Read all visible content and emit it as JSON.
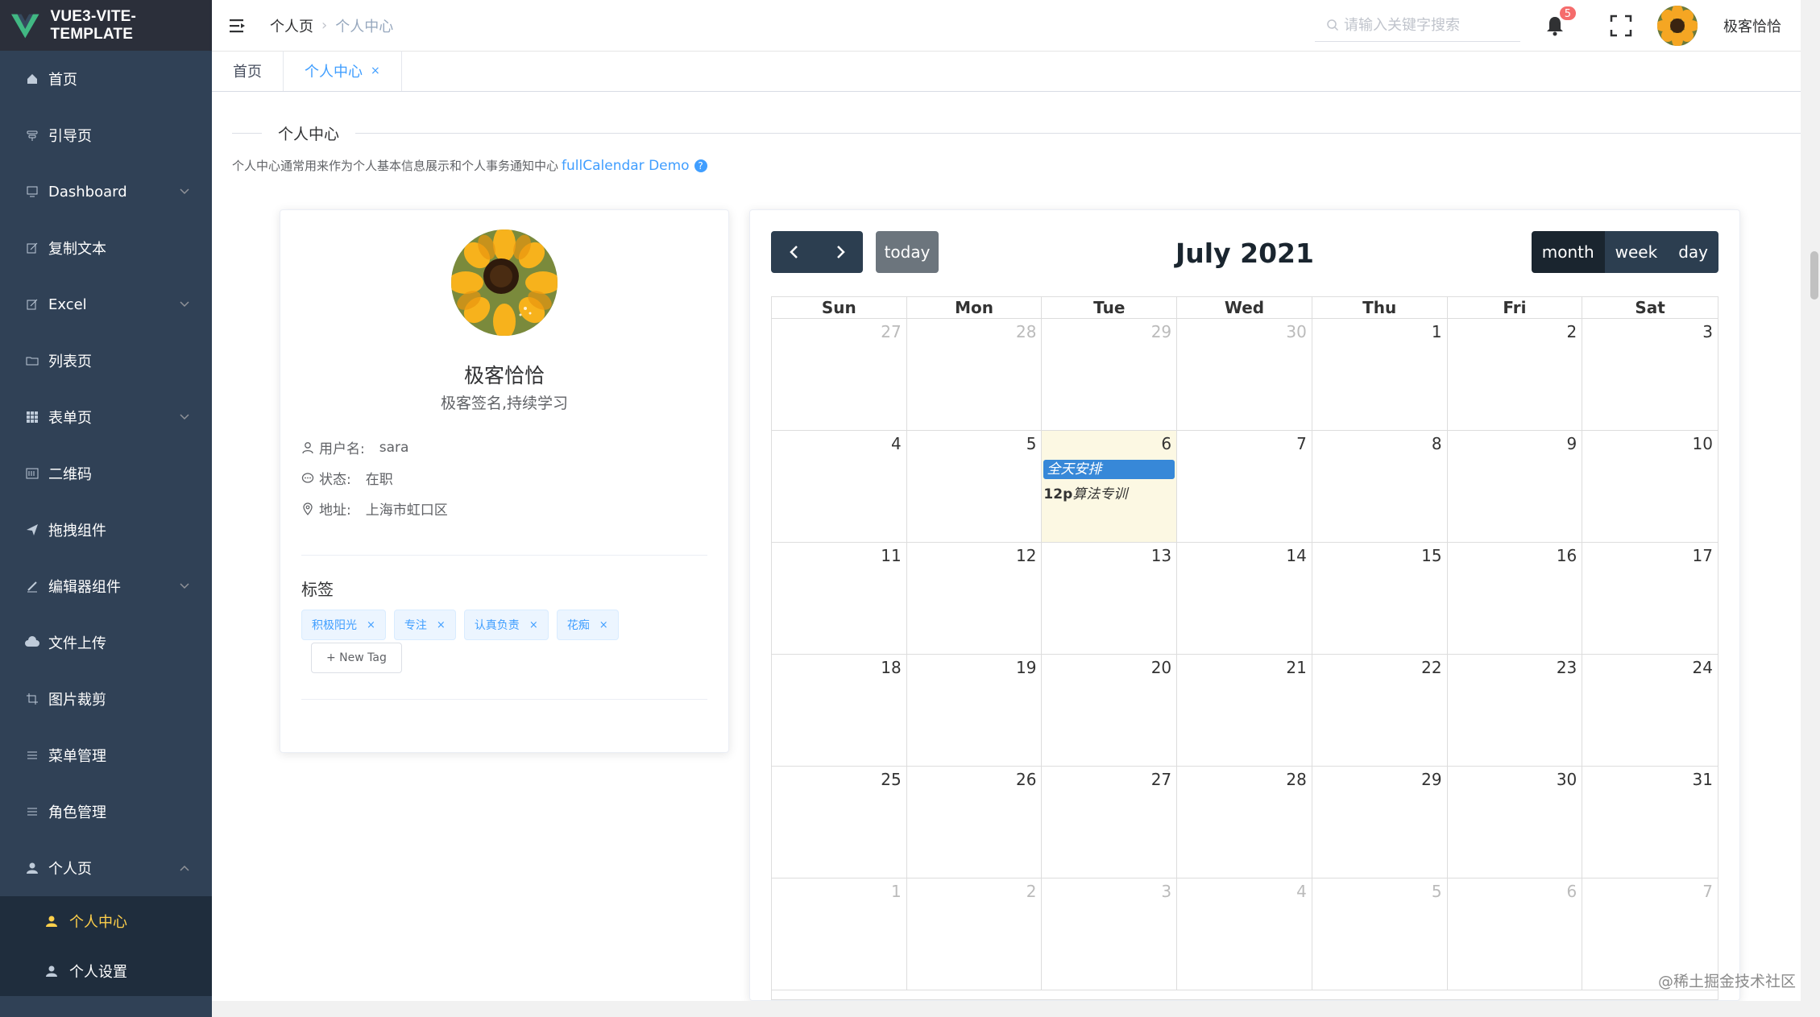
{
  "app": {
    "logo_text": "VUE3-VITE-TEMPLATE"
  },
  "sidebar": {
    "items": [
      {
        "label": "首页",
        "icon": "home-icon",
        "has_arrow": false
      },
      {
        "label": "引导页",
        "icon": "guide-icon",
        "has_arrow": false
      },
      {
        "label": "Dashboard",
        "icon": "dashboard-icon",
        "has_arrow": true
      },
      {
        "label": "复制文本",
        "icon": "copy-icon",
        "has_arrow": false
      },
      {
        "label": "Excel",
        "icon": "excel-icon",
        "has_arrow": true
      },
      {
        "label": "列表页",
        "icon": "folder-icon",
        "has_arrow": false
      },
      {
        "label": "表单页",
        "icon": "grid-icon",
        "has_arrow": true
      },
      {
        "label": "二维码",
        "icon": "qrcode-icon",
        "has_arrow": false
      },
      {
        "label": "拖拽组件",
        "icon": "send-icon",
        "has_arrow": false
      },
      {
        "label": "编辑器组件",
        "icon": "edit-icon",
        "has_arrow": true
      },
      {
        "label": "文件上传",
        "icon": "cloud-upload-icon",
        "has_arrow": false
      },
      {
        "label": "图片裁剪",
        "icon": "crop-icon",
        "has_arrow": false
      },
      {
        "label": "菜单管理",
        "icon": "list-icon",
        "has_arrow": false
      },
      {
        "label": "角色管理",
        "icon": "list-icon",
        "has_arrow": false
      },
      {
        "label": "个人页",
        "icon": "user-icon",
        "has_arrow": true
      }
    ],
    "submenu": [
      {
        "label": "个人中心",
        "active": true
      },
      {
        "label": "个人设置",
        "active": false
      }
    ]
  },
  "header": {
    "breadcrumb": [
      "个人页",
      "个人中心"
    ],
    "search_placeholder": "请输入关键字搜索",
    "notification_count": "5",
    "username": "极客恰恰"
  },
  "tags_view": {
    "tabs": [
      {
        "label": "首页",
        "active": false
      },
      {
        "label": "个人中心",
        "active": true,
        "close": "×"
      }
    ]
  },
  "main": {
    "divider_text": "个人中心",
    "description": "个人中心通常用来作为个人基本信息展示和个人事务通知中心",
    "link_text": "fullCalendar Demo",
    "help_icon": "?"
  },
  "profile": {
    "name": "极客恰恰",
    "signature": "极客签名,持续学习",
    "info": [
      {
        "icon": "user-icon",
        "label": "用户名:",
        "value": "sara"
      },
      {
        "icon": "chat-icon",
        "label": "状态:",
        "value": "在职"
      },
      {
        "icon": "location-icon",
        "label": "地址:",
        "value": "上海市虹口区"
      }
    ],
    "tags_title": "标签",
    "tags": [
      "积极阳光",
      "专注",
      "认真负责",
      "花痴"
    ],
    "tag_close": "×",
    "new_tag_label": "+ New Tag"
  },
  "calendar": {
    "title": "July 2021",
    "prev_icon": "chevron-left-icon",
    "next_icon": "chevron-right-icon",
    "today_label": "today",
    "views": [
      {
        "label": "month",
        "active": true
      },
      {
        "label": "week",
        "active": false
      },
      {
        "label": "day",
        "active": false
      }
    ],
    "weekdays": [
      "Sun",
      "Mon",
      "Tue",
      "Wed",
      "Thu",
      "Fri",
      "Sat"
    ],
    "weeks": [
      [
        {
          "n": "27",
          "o": true
        },
        {
          "n": "28",
          "o": true
        },
        {
          "n": "29",
          "o": true
        },
        {
          "n": "30",
          "o": true
        },
        {
          "n": "1"
        },
        {
          "n": "2"
        },
        {
          "n": "3"
        }
      ],
      [
        {
          "n": "4"
        },
        {
          "n": "5"
        },
        {
          "n": "6",
          "today": true
        },
        {
          "n": "7"
        },
        {
          "n": "8"
        },
        {
          "n": "9"
        },
        {
          "n": "10"
        }
      ],
      [
        {
          "n": "11"
        },
        {
          "n": "12"
        },
        {
          "n": "13"
        },
        {
          "n": "14"
        },
        {
          "n": "15"
        },
        {
          "n": "16"
        },
        {
          "n": "17"
        }
      ],
      [
        {
          "n": "18"
        },
        {
          "n": "19"
        },
        {
          "n": "20"
        },
        {
          "n": "21"
        },
        {
          "n": "22"
        },
        {
          "n": "23"
        },
        {
          "n": "24"
        }
      ],
      [
        {
          "n": "25"
        },
        {
          "n": "26"
        },
        {
          "n": "27"
        },
        {
          "n": "28"
        },
        {
          "n": "29"
        },
        {
          "n": "30"
        },
        {
          "n": "31"
        }
      ],
      [
        {
          "n": "1",
          "o": true
        },
        {
          "n": "2",
          "o": true
        },
        {
          "n": "3",
          "o": true
        },
        {
          "n": "4",
          "o": true
        },
        {
          "n": "5",
          "o": true
        },
        {
          "n": "6",
          "o": true
        },
        {
          "n": "7",
          "o": true
        }
      ]
    ],
    "events": {
      "all_day": "全天安排",
      "timed_time": "12p",
      "timed_title": "算法专训"
    },
    "colors": {
      "event": "#3788d8",
      "today_bg": "#fcf8e3",
      "button": "#2c3e50"
    }
  },
  "watermark": "@稀土掘金技术社区"
}
